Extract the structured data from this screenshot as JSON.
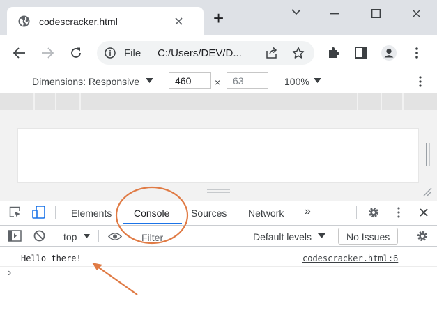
{
  "browser": {
    "tab_title": "codescracker.html",
    "new_tab_symbol": "+",
    "url_scheme_label": "File",
    "url_text": "C:/Users/DEV/D...",
    "icons": [
      "globe-icon",
      "back-arrow-icon",
      "forward-arrow-icon",
      "reload-icon",
      "info-icon",
      "share-icon",
      "star-icon",
      "puzzle-icon",
      "sidepanel-icon",
      "profile-icon",
      "kebab-icon",
      "chevron-down-icon",
      "minimize-icon",
      "maximize-icon",
      "close-icon"
    ]
  },
  "device_toolbar": {
    "dimensions_label": "Dimensions: Responsive",
    "width_value": "460",
    "times_symbol": "×",
    "height_value": "63",
    "zoom_label": "100%"
  },
  "devtools": {
    "tabs": [
      {
        "label": "Elements"
      },
      {
        "label": "Console",
        "active": true
      },
      {
        "label": "Sources"
      },
      {
        "label": "Network"
      }
    ],
    "more_tabs_symbol": "»",
    "console_toolbar": {
      "context_label": "top",
      "filter_placeholder": "Filter",
      "levels_label": "Default levels",
      "issues_label": "No Issues"
    },
    "console": {
      "message": "Hello there!",
      "source_link": "codescracker.html:6",
      "prompt_symbol": "›"
    }
  },
  "annotation": {
    "color": "#e07b45"
  },
  "colors": {
    "tabstrip_bg": "#dee1e6",
    "active_tab_underline": "#1a73e8",
    "icon_gray": "#5f6368"
  }
}
